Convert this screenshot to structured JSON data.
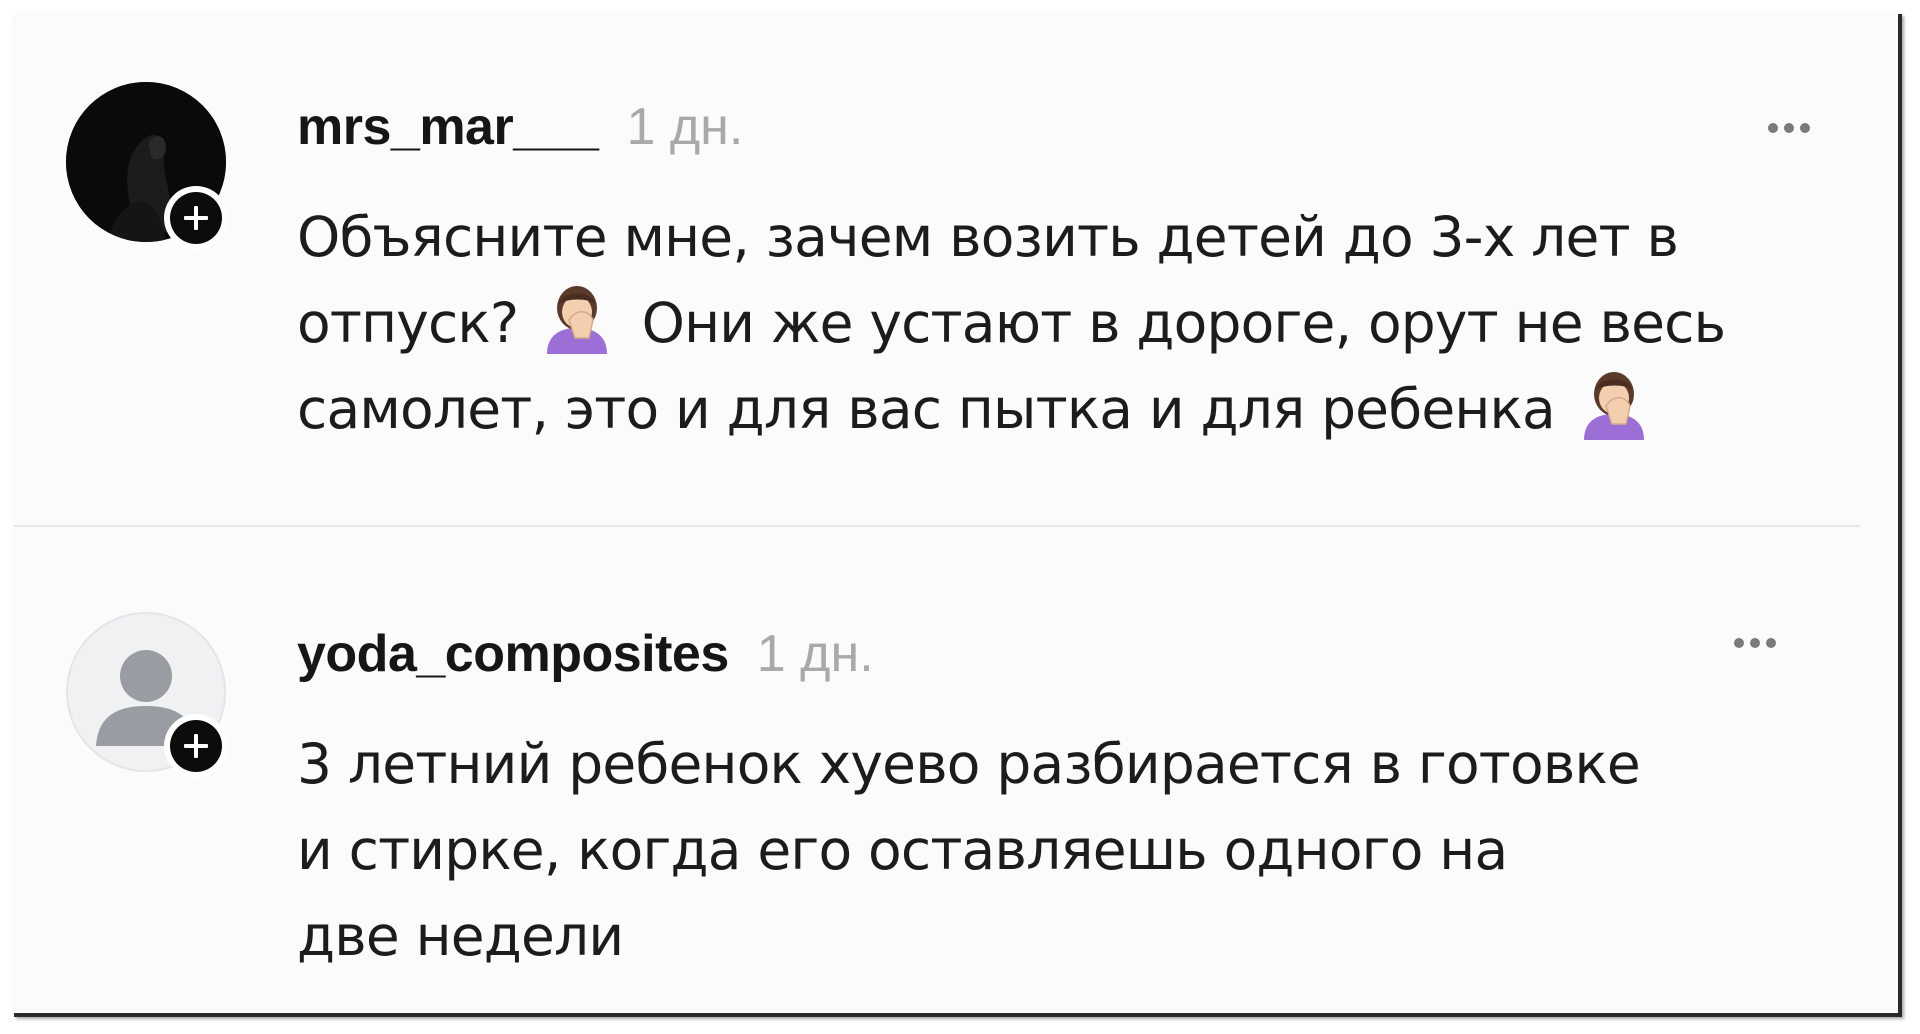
{
  "comments": [
    {
      "username": "mrs_mar___",
      "timestamp": "1 дн.",
      "avatar": "dark-photo-avatar",
      "follow_icon": "plus-icon",
      "more_icon": "more-dots-icon",
      "lines": [
        "Объясните мне, зачем возить детей до 3-х лет в",
        {
          "before": "отпуск?",
          "emoji": "face-palm-woman-emoji",
          "after": "Они же устают в дороге, орут не весь"
        },
        {
          "before": "самолет, это и для вас пытка и для ребенка",
          "emoji": "face-palm-woman-emoji",
          "after": ""
        }
      ]
    },
    {
      "username": "yoda_composites",
      "timestamp": "1 дн.",
      "avatar": "default-user-avatar",
      "follow_icon": "plus-icon",
      "more_icon": "more-dots-icon",
      "lines": [
        "3 летний ребенок хуево разбирается в готовке",
        "и стирке, когда его оставляешь одного на",
        "две недели"
      ]
    }
  ],
  "colors": {
    "username": "#161616",
    "timestamp": "#a9a9a9",
    "text": "#1c1c1c",
    "badge": "#0c0c0c",
    "emoji_shirt": "#9b6fd6"
  }
}
